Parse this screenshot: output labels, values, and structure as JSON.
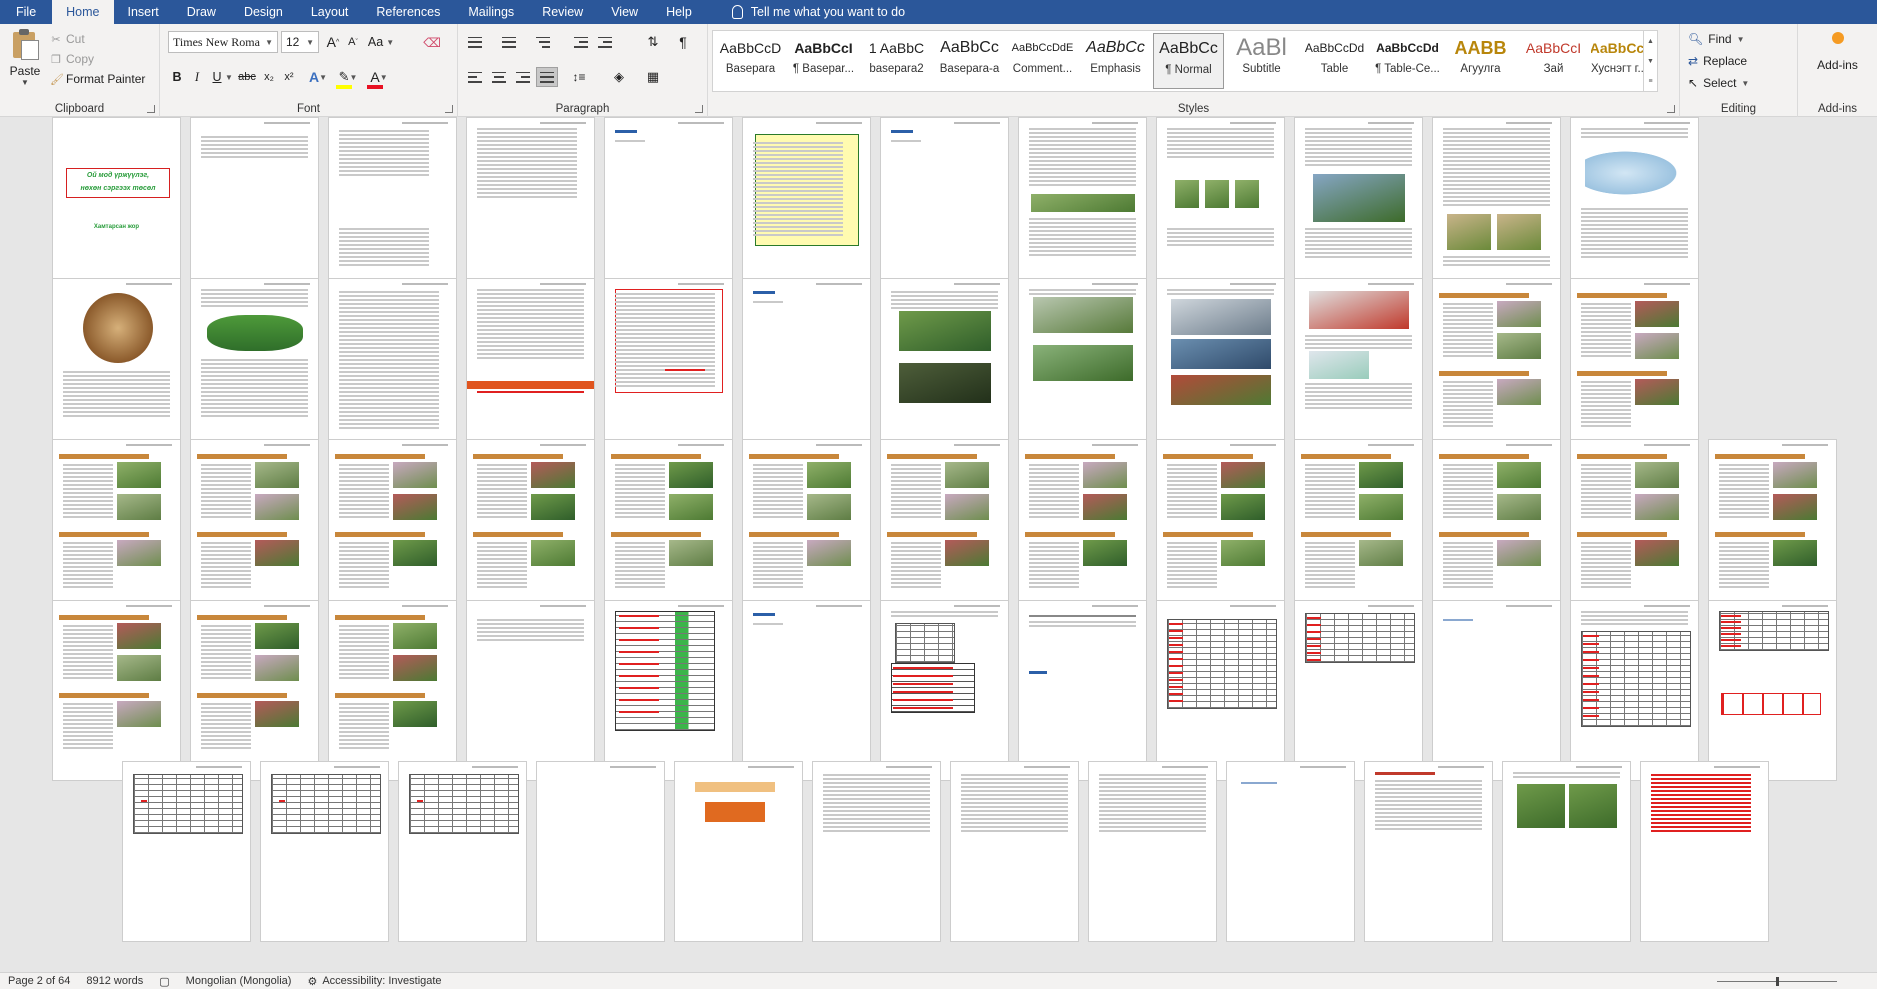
{
  "tabs": [
    {
      "label": "File"
    },
    {
      "label": "Home"
    },
    {
      "label": "Insert"
    },
    {
      "label": "Draw"
    },
    {
      "label": "Design"
    },
    {
      "label": "Layout"
    },
    {
      "label": "References"
    },
    {
      "label": "Mailings"
    },
    {
      "label": "Review"
    },
    {
      "label": "View"
    },
    {
      "label": "Help"
    }
  ],
  "tell_me": "Tell me what you want to do",
  "clipboard": {
    "paste": "Paste",
    "cut": "Cut",
    "copy": "Copy",
    "format_painter": "Format Painter",
    "group": "Clipboard"
  },
  "font": {
    "family": "Times New Roma",
    "size": "12",
    "bold": "B",
    "italic": "I",
    "underline": "U",
    "strikethrough": "abc",
    "subscript": "x₂",
    "superscript": "x²",
    "grow": "A",
    "shrink": "A",
    "case": "Aa",
    "group": "Font",
    "highlight_color": "#ffff00",
    "font_color": "#e81123"
  },
  "paragraph": {
    "group": "Paragraph"
  },
  "styles": {
    "group": "Styles",
    "items": [
      {
        "preview": "AaBbCcD",
        "name": "Basepara"
      },
      {
        "preview": "AaBbCcI",
        "name": "¶ Basepar..."
      },
      {
        "preview": "1 AaBbC",
        "name": "basepara2"
      },
      {
        "preview": "AaBbCc",
        "name": "Basepara-a"
      },
      {
        "preview": "AaBbCcDdE",
        "name": "Comment..."
      },
      {
        "preview": "AaBbCc",
        "name": "Emphasis"
      },
      {
        "preview": "AaBbCc",
        "name": "¶ Normal"
      },
      {
        "preview": "AaBl",
        "name": "Subtitle"
      },
      {
        "preview": "AaBbCcDd",
        "name": "Table"
      },
      {
        "preview": "AaBbCcDd",
        "name": "¶ Table-Ce..."
      },
      {
        "preview": "AABB",
        "name": "Агуулга"
      },
      {
        "preview": "AaBbCcI",
        "name": "Зай"
      },
      {
        "preview": "AaBbCc",
        "name": "Хуснэгт г..."
      }
    ]
  },
  "editing": {
    "find": "Find",
    "replace": "Replace",
    "select": "Select",
    "group": "Editing"
  },
  "addins": {
    "label": "Add-ins",
    "group": "Add-ins"
  },
  "status": {
    "page": "Page 2 of 64",
    "words": "8912 words",
    "language": "Mongolian (Mongolia)",
    "accessibility": "Accessibility: Investigate"
  },
  "cover": {
    "title_line1": "Ой мод үржүүлэг,",
    "title_line2": "нөхөн сэргээх төсөл",
    "subtitle": "Хамтарсан жор"
  },
  "colors": {
    "accent": "#2b579a",
    "ribbon_bg": "#f3f2f1",
    "page_band": "#c8873b",
    "table_red": "#e02020",
    "table_green": "#3bb54a"
  }
}
